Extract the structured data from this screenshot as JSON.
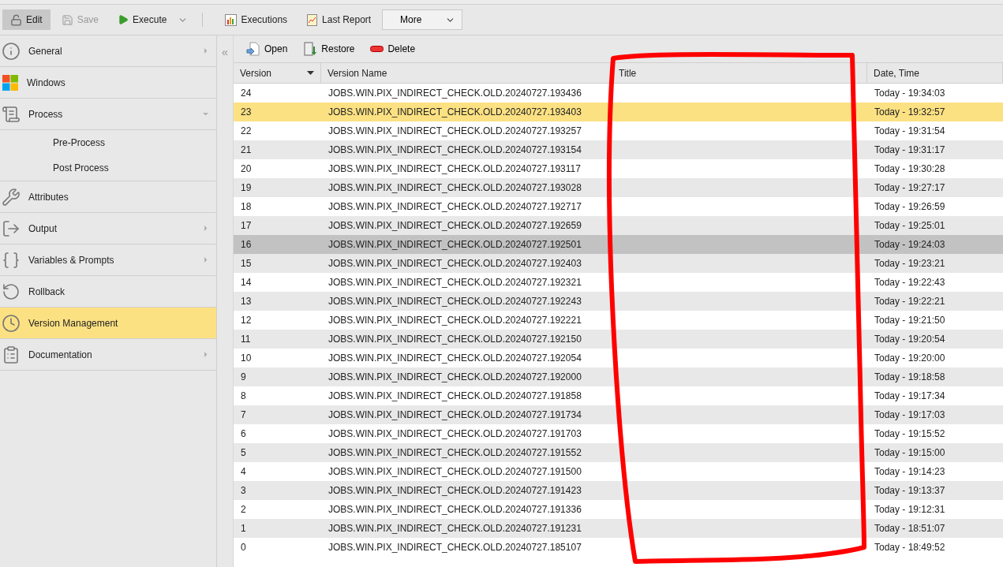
{
  "toolbar": {
    "buttons": [
      {
        "label": "Edit",
        "kind": "edit",
        "selected": true,
        "disabled": false
      },
      {
        "label": "Save",
        "kind": "save",
        "selected": false,
        "disabled": true
      },
      {
        "label": "Execute",
        "kind": "execute",
        "selected": false,
        "disabled": false
      },
      {
        "label": "Executions",
        "kind": "executions",
        "selected": false,
        "disabled": false
      },
      {
        "label": "Last Report",
        "kind": "report",
        "selected": false,
        "disabled": false
      }
    ],
    "more": {
      "label": "More"
    }
  },
  "sidebar": {
    "items": [
      {
        "label": "General",
        "kind": "info",
        "selected": false,
        "expanded": false
      },
      {
        "label": "Windows",
        "kind": "windows",
        "selected": false
      },
      {
        "label": "Process",
        "kind": "process",
        "selected": false,
        "expanded": true,
        "children": [
          {
            "label": "Pre-Process"
          },
          {
            "label": "Post Process"
          }
        ]
      },
      {
        "label": "Attributes",
        "kind": "attributes",
        "selected": false
      },
      {
        "label": "Output",
        "kind": "output",
        "selected": false,
        "expanded": false
      },
      {
        "label": "Variables & Prompts",
        "kind": "variables",
        "selected": false,
        "expanded": false
      },
      {
        "label": "Rollback",
        "kind": "rollback",
        "selected": false
      },
      {
        "label": "Version Management",
        "kind": "version",
        "selected": true
      },
      {
        "label": "Documentation",
        "kind": "documentation",
        "selected": false,
        "expanded": false
      }
    ]
  },
  "collapse": "«",
  "actions": [
    {
      "label": "Open",
      "kind": "open"
    },
    {
      "label": "Restore",
      "kind": "restore"
    },
    {
      "label": "Delete",
      "kind": "delete"
    }
  ],
  "table": {
    "columns": [
      {
        "label": "Version",
        "sorted": true
      },
      {
        "label": "Version Name",
        "sorted": false
      },
      {
        "label": "Title",
        "sorted": false
      },
      {
        "label": "Date, Time",
        "sorted": false
      }
    ],
    "rows": [
      {
        "version": "24",
        "name": "JOBS.WIN.PIX_INDIRECT_CHECK.OLD.20240727.193436",
        "date": "Today - 19:34:03",
        "selected": false,
        "hovered": false
      },
      {
        "version": "23",
        "name": "JOBS.WIN.PIX_INDIRECT_CHECK.OLD.20240727.193403",
        "date": "Today - 19:32:57",
        "selected": true,
        "hovered": false
      },
      {
        "version": "22",
        "name": "JOBS.WIN.PIX_INDIRECT_CHECK.OLD.20240727.193257",
        "date": "Today - 19:31:54",
        "selected": false,
        "hovered": false
      },
      {
        "version": "21",
        "name": "JOBS.WIN.PIX_INDIRECT_CHECK.OLD.20240727.193154",
        "date": "Today - 19:31:17",
        "selected": false,
        "hovered": false
      },
      {
        "version": "20",
        "name": "JOBS.WIN.PIX_INDIRECT_CHECK.OLD.20240727.193117",
        "date": "Today - 19:30:28",
        "selected": false,
        "hovered": false
      },
      {
        "version": "19",
        "name": "JOBS.WIN.PIX_INDIRECT_CHECK.OLD.20240727.193028",
        "date": "Today - 19:27:17",
        "selected": false,
        "hovered": false
      },
      {
        "version": "18",
        "name": "JOBS.WIN.PIX_INDIRECT_CHECK.OLD.20240727.192717",
        "date": "Today - 19:26:59",
        "selected": false,
        "hovered": false
      },
      {
        "version": "17",
        "name": "JOBS.WIN.PIX_INDIRECT_CHECK.OLD.20240727.192659",
        "date": "Today - 19:25:01",
        "selected": false,
        "hovered": false
      },
      {
        "version": "16",
        "name": "JOBS.WIN.PIX_INDIRECT_CHECK.OLD.20240727.192501",
        "date": "Today - 19:24:03",
        "selected": false,
        "hovered": true
      },
      {
        "version": "15",
        "name": "JOBS.WIN.PIX_INDIRECT_CHECK.OLD.20240727.192403",
        "date": "Today - 19:23:21",
        "selected": false,
        "hovered": false
      },
      {
        "version": "14",
        "name": "JOBS.WIN.PIX_INDIRECT_CHECK.OLD.20240727.192321",
        "date": "Today - 19:22:43",
        "selected": false,
        "hovered": false
      },
      {
        "version": "13",
        "name": "JOBS.WIN.PIX_INDIRECT_CHECK.OLD.20240727.192243",
        "date": "Today - 19:22:21",
        "selected": false,
        "hovered": false
      },
      {
        "version": "12",
        "name": "JOBS.WIN.PIX_INDIRECT_CHECK.OLD.20240727.192221",
        "date": "Today - 19:21:50",
        "selected": false,
        "hovered": false
      },
      {
        "version": "11",
        "name": "JOBS.WIN.PIX_INDIRECT_CHECK.OLD.20240727.192150",
        "date": "Today - 19:20:54",
        "selected": false,
        "hovered": false
      },
      {
        "version": "10",
        "name": "JOBS.WIN.PIX_INDIRECT_CHECK.OLD.20240727.192054",
        "date": "Today - 19:20:00",
        "selected": false,
        "hovered": false
      },
      {
        "version": "9",
        "name": "JOBS.WIN.PIX_INDIRECT_CHECK.OLD.20240727.192000",
        "date": "Today - 19:18:58",
        "selected": false,
        "hovered": false
      },
      {
        "version": "8",
        "name": "JOBS.WIN.PIX_INDIRECT_CHECK.OLD.20240727.191858",
        "date": "Today - 19:17:34",
        "selected": false,
        "hovered": false
      },
      {
        "version": "7",
        "name": "JOBS.WIN.PIX_INDIRECT_CHECK.OLD.20240727.191734",
        "date": "Today - 19:17:03",
        "selected": false,
        "hovered": false
      },
      {
        "version": "6",
        "name": "JOBS.WIN.PIX_INDIRECT_CHECK.OLD.20240727.191703",
        "date": "Today - 19:15:52",
        "selected": false,
        "hovered": false
      },
      {
        "version": "5",
        "name": "JOBS.WIN.PIX_INDIRECT_CHECK.OLD.20240727.191552",
        "date": "Today - 19:15:00",
        "selected": false,
        "hovered": false
      },
      {
        "version": "4",
        "name": "JOBS.WIN.PIX_INDIRECT_CHECK.OLD.20240727.191500",
        "date": "Today - 19:14:23",
        "selected": false,
        "hovered": false
      },
      {
        "version": "3",
        "name": "JOBS.WIN.PIX_INDIRECT_CHECK.OLD.20240727.191423",
        "date": "Today - 19:13:37",
        "selected": false,
        "hovered": false
      },
      {
        "version": "2",
        "name": "JOBS.WIN.PIX_INDIRECT_CHECK.OLD.20240727.191336",
        "date": "Today - 19:12:31",
        "selected": false,
        "hovered": false
      },
      {
        "version": "1",
        "name": "JOBS.WIN.PIX_INDIRECT_CHECK.OLD.20240727.191231",
        "date": "Today - 18:51:07",
        "selected": false,
        "hovered": false
      },
      {
        "version": "0",
        "name": "JOBS.WIN.PIX_INDIRECT_CHECK.OLD.20240727.185107",
        "date": "Today - 18:49:52",
        "selected": false,
        "hovered": false
      }
    ]
  },
  "annotation": {
    "kind": "outline",
    "color": "#ff0000"
  }
}
